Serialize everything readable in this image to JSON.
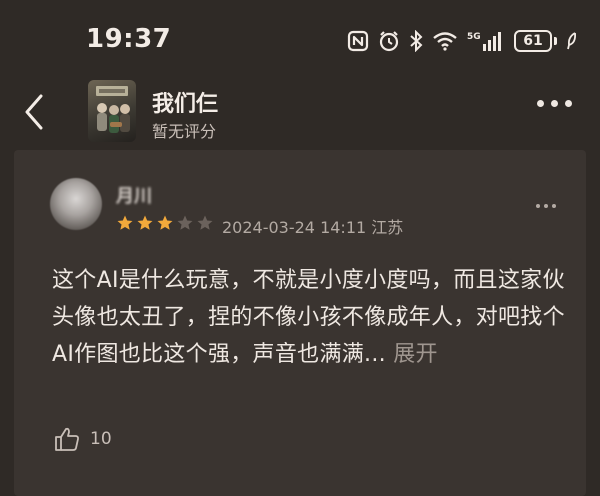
{
  "status_bar": {
    "time": "19:37",
    "network_label": "5G",
    "battery_level": "61"
  },
  "header": {
    "title": "我们仨",
    "rating": "暂无评分"
  },
  "review": {
    "reviewer_name": "月川",
    "rating_stars": 3,
    "rating_max": 5,
    "star_color": "#f2a93b",
    "empty_star_color": "#6b625c",
    "date": "2024-03-24 14:11",
    "location": "江苏",
    "text": "这个AI是什么玩意，不就是小度小度吗，而且这家伙头像也太丑了，捏的不像小孩不像成年人，对吧找个AI作图也比这个强，声音也满满...",
    "expand_label": "展开",
    "like_count": "10"
  }
}
